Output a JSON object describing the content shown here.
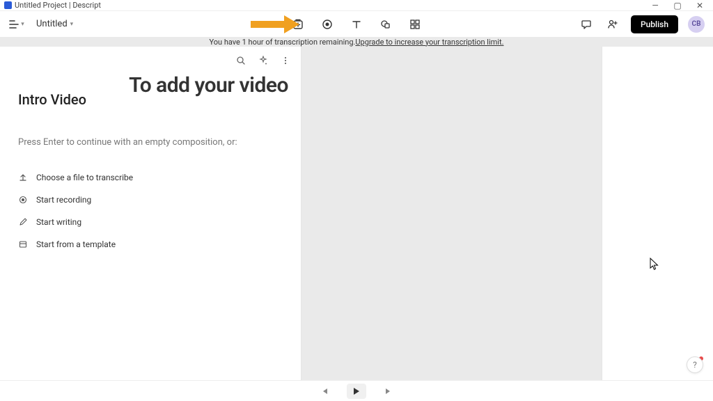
{
  "window": {
    "title": "Untitled Project | Descript"
  },
  "toolbar": {
    "project_name": "Untitled",
    "publish_label": "Publish",
    "avatar_initials": "CB"
  },
  "notice": {
    "text_before": "You have 1 hour of transcription remaining. ",
    "link_text": "Upgrade to increase your transcription limit."
  },
  "script": {
    "section_title": "Intro Video",
    "overlay_heading": "To add your video",
    "hint": "Press Enter to continue with an empty composition, or:",
    "options": {
      "choose_file": "Choose a file to transcribe",
      "start_recording": "Start recording",
      "start_writing": "Start writing",
      "start_template": "Start from a template"
    }
  },
  "icons": {
    "list": "list-icon",
    "add_media": "add-media-icon",
    "record": "record-icon",
    "text": "text-icon",
    "shapes": "shapes-icon",
    "grid": "grid-icon",
    "comment": "comment-icon",
    "share": "share-person-icon",
    "search": "search-icon",
    "sparkle": "sparkle-icon",
    "more": "more-vertical-icon"
  },
  "annotation": {
    "arrow_color": "#f0a020"
  }
}
